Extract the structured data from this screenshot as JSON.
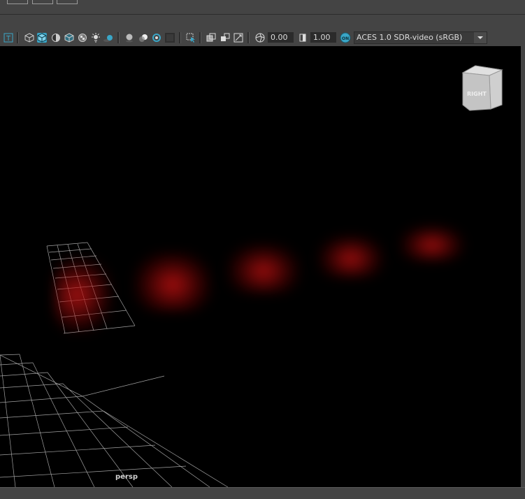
{
  "app": {
    "camera_name": "persp"
  },
  "toolbar": {
    "exposure_value": "0.00",
    "gamma_value": "1.00",
    "color_management_badge": "ON",
    "color_management_view": "ACES 1.0 SDR-video (sRGB)"
  },
  "view_cube": {
    "face_label": "RIGHT"
  },
  "colors": {
    "panel_bg": "#444444",
    "viewport_bg": "#000000",
    "accent": "#3aa6c7",
    "fog_red": "#c01010",
    "grid": "#bfbfbf"
  },
  "icons": [
    "text-icon",
    "wireframe-cube-icon",
    "shaded-cube-icon",
    "half-shaded-icon",
    "textured-cube-icon",
    "checker-icon",
    "light-icon",
    "shadow-icon",
    "ambient-occlusion-icon",
    "motion-blur-icon",
    "anti-alias-icon",
    "depth-of-field-icon",
    "isolate-select-icon",
    "xray-icon",
    "xray-joints-icon",
    "resolution-gate-icon",
    "exposure-icon",
    "gamma-icon",
    "color-management-icon"
  ]
}
